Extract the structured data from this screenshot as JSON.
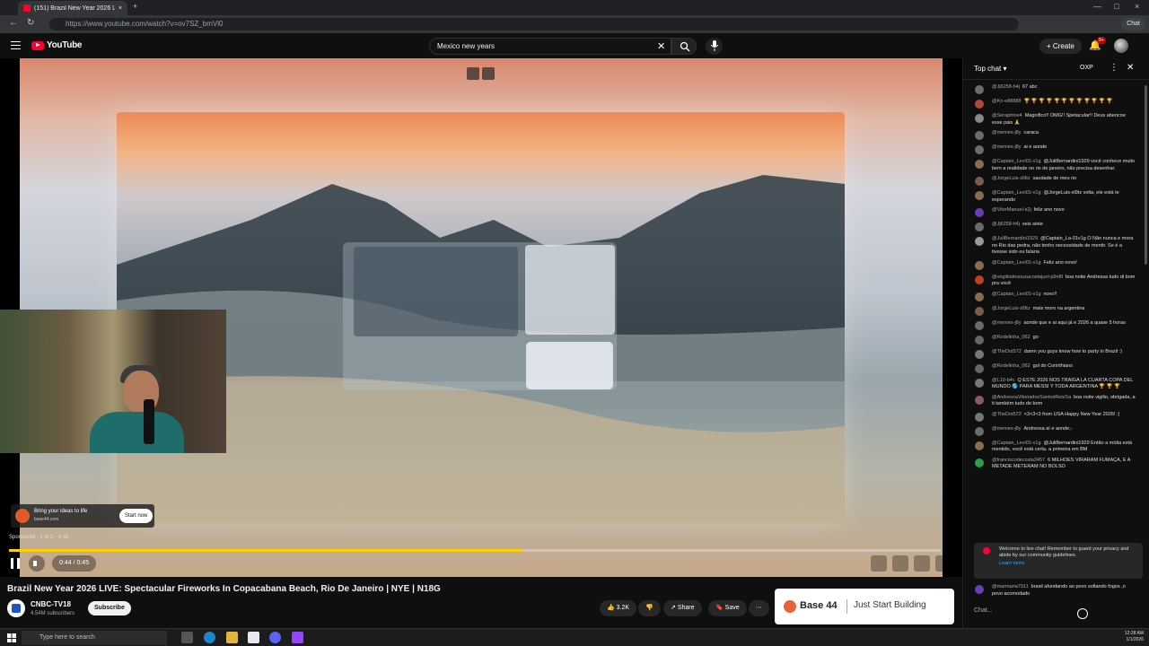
{
  "browser": {
    "tab_title": "(151) Brazil New Year 2026 Li...",
    "url": "https://www.youtube.com/watch?v=ov7SZ_bmVl0",
    "chat_button": "Chat"
  },
  "header": {
    "logo_text": "YouTube",
    "search_value": "Mexico new years",
    "create_label": "Create",
    "notif_count": "9+"
  },
  "player": {
    "ad_title": "Bring your ideas to life",
    "ad_domain": "base44.com",
    "ad_cta": "Start now",
    "sponsored": "Sponsored · 1 of 2 · 0:45",
    "time": "0:44 / 0:45",
    "progress_fraction": 0.55
  },
  "video": {
    "title": "Brazil New Year 2026 LIVE: Spectacular Fireworks In Copacabana Beach, Rio De Janeiro | NYE | N18G",
    "channel": "CNBC-TV18",
    "subscribers": "4.54M subscribers",
    "subscribe_label": "Subscribe",
    "likes": "3.2K",
    "share_label": "Share",
    "save_label": "Save"
  },
  "banner": {
    "name": "Base 44",
    "tagline": "Just Start Building"
  },
  "chat": {
    "mode": "Top chat",
    "oxp": "OXP",
    "messages": [
      {
        "author": "@Jj6258-h4j",
        "text": "67 abc",
        "color": "#6b6b6b"
      },
      {
        "author": "@Ko-e88888",
        "text": "🏆 🏆 🏆 🏆 🏆 🏆 🏆 🏆 🏆 🏆 🏆 🏆",
        "color": "#b3473c"
      },
      {
        "author": "@Seraphine4",
        "text": "Magnifico!! OMG!! Spetacular!! Deus abencoe esse pais 🙏",
        "color": "#888"
      },
      {
        "author": "@memes-j8y",
        "text": "caraca",
        "color": "#6b6b6b"
      },
      {
        "author": "@memes-j8y",
        "text": "ai e aonde",
        "color": "#6b6b6b"
      },
      {
        "author": "@Captain_Levi01-v1g",
        "text": "@JuliBernardini1929 você conhece muito bem a realidade no rio de janeiro, não precisa desenhar.",
        "color": "#8a6d4f"
      },
      {
        "author": "@JorgeLuis-xl9tz",
        "text": "saudade de meu rio",
        "color": "#7a5c4c"
      },
      {
        "author": "@Captain_Levi01-v1g",
        "text": "@JorgeLuis-xl9tz volta, ele está te esperando",
        "color": "#8a6d4f"
      },
      {
        "author": "@VitorManuel-s2j",
        "text": "feliz ano novo",
        "color": "#6a3fb5"
      },
      {
        "author": "@Jj6258-h4j",
        "text": "seis siete",
        "color": "#6b6b6b"
      },
      {
        "author": "@JuliBernardini1929",
        "text": "@Captain_La-01v1g O Não nunca e mora no Rio das pedra, não tenho necessidade de mentir. Se é a tivesse sido eu falaria",
        "color": "#999"
      },
      {
        "author": "@Captain_Levi01-v1g",
        "text": "Feliz ano novo!",
        "color": "#8a6d4f"
      },
      {
        "author": "@virgiliodesouzacostajunl-p9n8l",
        "text": "boa noite Andressa tudo di bom pra você",
        "color": "#c04020"
      },
      {
        "author": "@Captain_Levi01-v1g",
        "text": "novo!!",
        "color": "#8a6d4f"
      },
      {
        "author": "@JorgeLuis-xl9tz",
        "text": "mais moro na argentina",
        "color": "#7a5c4c"
      },
      {
        "author": "@memes-j8y",
        "text": "aonde que e ai aqui já e 2026 a quase 5 horas",
        "color": "#6b6b6b"
      },
      {
        "author": "@Rodelinha_062",
        "text": "go",
        "color": "#666"
      },
      {
        "author": "@TheDot572",
        "text": "damn you guys know how to party in Brazil :)",
        "color": "#777"
      },
      {
        "author": "@Rodelinha_062",
        "text": "gol do Corinthians",
        "color": "#666"
      },
      {
        "author": "@L10-b4c",
        "text": "Q ESTE 2026 NOS TRAIGA LA CUARTA COPA DEL MUNDO 🌎 PARA MESSI Y TODA ARGENTINA 🏆 🏆 🏆",
        "color": "#777"
      },
      {
        "author": "@AndressaVitoriadosSantosReisSa",
        "text": "boa noite vigilio, obrigada, a ti também tudo de bom",
        "color": "#8a5a6a"
      },
      {
        "author": "@TheDot572",
        "text": "<3<3<3 from USA Happy New Year 2026! :)",
        "color": "#777"
      },
      {
        "author": "@memes-j8y",
        "text": "Andressa aí e aonde;-",
        "color": "#6b6b6b"
      },
      {
        "author": "@Captain_Levi01-v1g",
        "text": "@JuliBernardini1929 Então a mídia está mentido, você está certa. a primeira em BM",
        "color": "#8a6d4f"
      },
      {
        "author": "@franciscodecosta3457",
        "text": "6 MILHOES VIRARAM FUMAÇA, E A METADE METERAM NO BOLSO",
        "color": "#2e9e4a"
      }
    ],
    "pinned": "Welcome to live chat! Remember to guard your privacy and abide by our community guidelines.",
    "learn_more": "Learn more",
    "last_author": "@marmaria7911",
    "last_text": "brasil afundando ao povo soltando fogos ,o povo acomodado",
    "input_placeholder": "Chat..."
  },
  "taskbar": {
    "search_placeholder": "Type here to search",
    "time": "12:28 AM",
    "date": "1/1/2026"
  }
}
